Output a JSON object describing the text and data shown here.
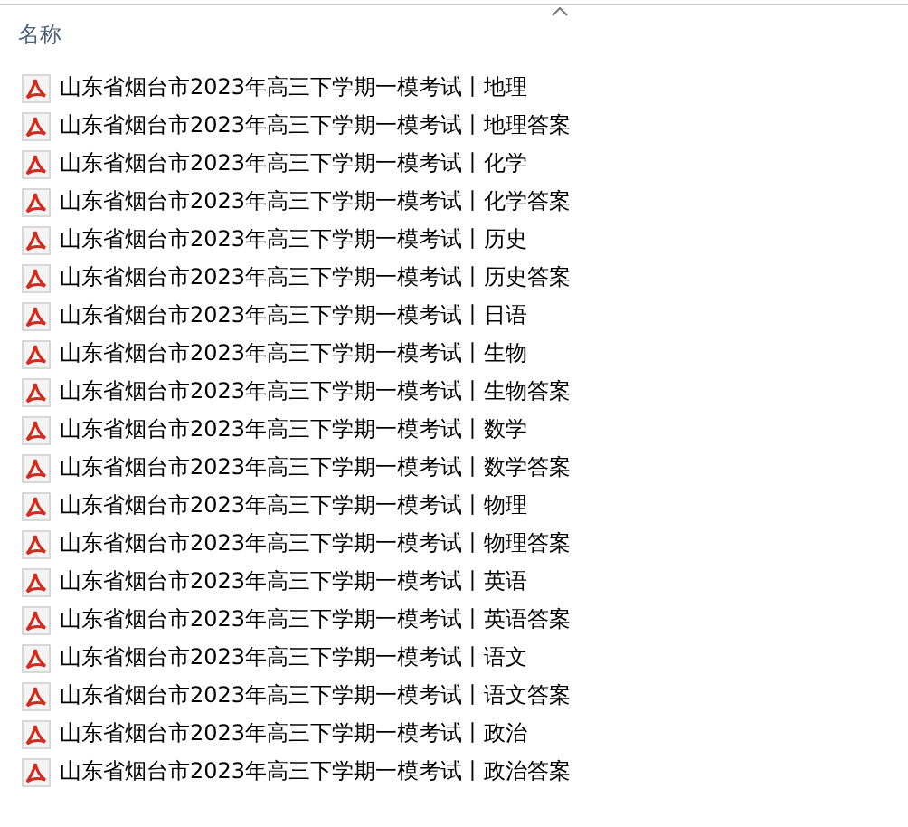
{
  "column_header": {
    "label": "名称",
    "sort_ascending": true
  },
  "files": [
    {
      "name": "山东省烟台市2023年高三下学期一模考试丨地理"
    },
    {
      "name": "山东省烟台市2023年高三下学期一模考试丨地理答案"
    },
    {
      "name": "山东省烟台市2023年高三下学期一模考试丨化学"
    },
    {
      "name": "山东省烟台市2023年高三下学期一模考试丨化学答案"
    },
    {
      "name": "山东省烟台市2023年高三下学期一模考试丨历史"
    },
    {
      "name": "山东省烟台市2023年高三下学期一模考试丨历史答案"
    },
    {
      "name": "山东省烟台市2023年高三下学期一模考试丨日语"
    },
    {
      "name": "山东省烟台市2023年高三下学期一模考试丨生物"
    },
    {
      "name": "山东省烟台市2023年高三下学期一模考试丨生物答案"
    },
    {
      "name": "山东省烟台市2023年高三下学期一模考试丨数学"
    },
    {
      "name": "山东省烟台市2023年高三下学期一模考试丨数学答案"
    },
    {
      "name": "山东省烟台市2023年高三下学期一模考试丨物理"
    },
    {
      "name": "山东省烟台市2023年高三下学期一模考试丨物理答案"
    },
    {
      "name": "山东省烟台市2023年高三下学期一模考试丨英语"
    },
    {
      "name": "山东省烟台市2023年高三下学期一模考试丨英语答案"
    },
    {
      "name": "山东省烟台市2023年高三下学期一模考试丨语文"
    },
    {
      "name": "山东省烟台市2023年高三下学期一模考试丨语文答案"
    },
    {
      "name": "山东省烟台市2023年高三下学期一模考试丨政治"
    },
    {
      "name": "山东省烟台市2023年高三下学期一模考试丨政治答案"
    }
  ]
}
